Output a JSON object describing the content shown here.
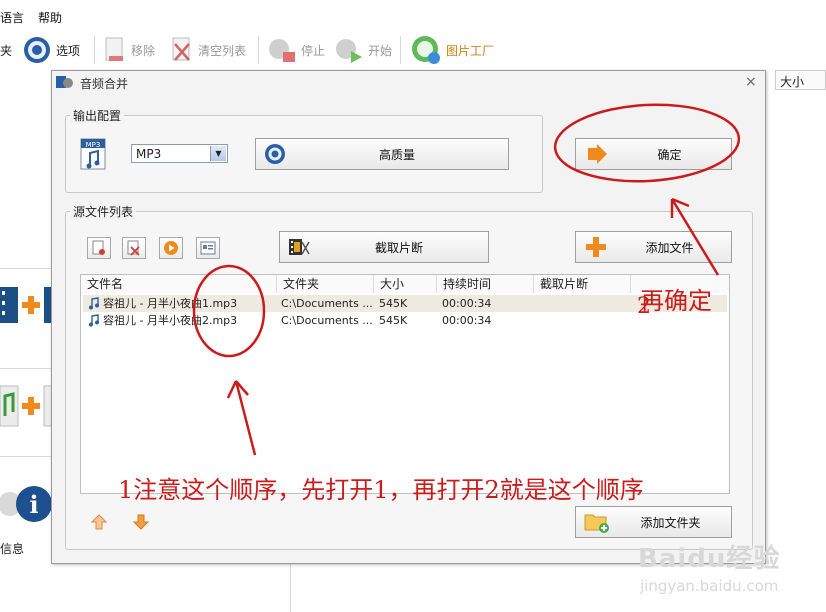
{
  "menu": {
    "language": "语言",
    "help": "帮助"
  },
  "toolbar": {
    "folder_partial": "夹",
    "options": "选项",
    "remove": "移除",
    "clear_list": "清空列表",
    "stop": "停止",
    "start": "开始",
    "image_factory": "图片工厂"
  },
  "left_panel": {
    "info_partial": "信息"
  },
  "background_column": {
    "size_header": "大小"
  },
  "dialog": {
    "title": "音频合并",
    "close": "×",
    "output_group": {
      "label": "输出配置",
      "format_value": "MP3",
      "quality_button": "高质量",
      "ok_button": "确定"
    },
    "source_group": {
      "label": "源文件列表",
      "clip_button": "截取片断",
      "add_file_button": "添加文件",
      "add_folder_button": "添加文件夹",
      "columns": [
        "文件名",
        "文件夹",
        "大小",
        "持续时间",
        "截取片断"
      ],
      "rows": [
        {
          "name": "容祖儿 - 月半小夜曲1.mp3",
          "folder": "C:\\Documents ...",
          "size": "545K",
          "duration": "00:00:34",
          "clip": ""
        },
        {
          "name": "容祖儿 - 月半小夜曲2.mp3",
          "folder": "C:\\Documents ...",
          "size": "545K",
          "duration": "00:00:34",
          "clip": ""
        }
      ]
    }
  },
  "annotations": {
    "confirm_note": "再确定",
    "order_note": "1注意这个顺序，先打开1，再打开2就是这个顺序",
    "color": "#cc1b1b"
  },
  "watermark": {
    "brand": "Baidu经验",
    "url": "jingyan.baidu.com"
  }
}
